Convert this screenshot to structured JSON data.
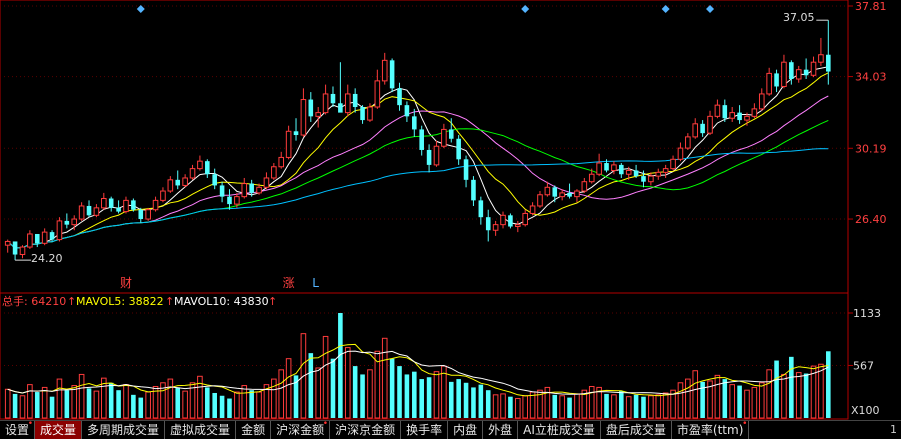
{
  "colors": {
    "up": "#ff3c3c",
    "down": "#54ffff",
    "ma5": "#ffffff",
    "ma10": "#ffff00",
    "ma20": "#ff80ff",
    "ma30": "#00ff00",
    "ma60": "#00c0ff",
    "axis": "#b40000",
    "grid": "#5a0000",
    "label": "#ff4040",
    "marker": "#54b4ff"
  },
  "price_panel": {
    "y_ticks": [
      "37.81",
      "34.03",
      "30.19",
      "26.40"
    ],
    "y_tick_values": [
      37.81,
      34.03,
      30.19,
      26.4
    ],
    "ylim": [
      22.6,
      37.81
    ],
    "high_label": "37.05",
    "low_label": "24.20",
    "event_labels": [
      {
        "text": "财",
        "index": 16
      },
      {
        "text": "涨",
        "index": 38
      },
      {
        "text": "L",
        "index": 42
      }
    ],
    "marker_indices": [
      18,
      70,
      89,
      95
    ]
  },
  "volume_panel": {
    "title": "总手",
    "total_label": "总手: 64210",
    "mavol5_label": "MAVOL5: 38822",
    "mavol10_label": "MAVOL10: 43830",
    "y_ticks": [
      "1133",
      "567"
    ],
    "y_tick_values": [
      1133,
      567
    ],
    "ylim": [
      0,
      1133
    ],
    "unit": "X100"
  },
  "tabs": [
    {
      "label": "设置",
      "dot": true
    },
    {
      "label": "成交量",
      "active": true
    },
    {
      "label": "多周期成交量"
    },
    {
      "label": "虚拟成交量"
    },
    {
      "label": "金额"
    },
    {
      "label": "沪深金额",
      "dot": true
    },
    {
      "label": "沪深京金额"
    },
    {
      "label": "换手率"
    },
    {
      "label": "内盘"
    },
    {
      "label": "外盘"
    },
    {
      "label": "AI立桩成交量"
    },
    {
      "label": "盘后成交量"
    },
    {
      "label": "市盈率(ttm)",
      "dot": true
    }
  ],
  "tab_right": "1",
  "chart_data": {
    "type": "candlestick",
    "candles": [
      [
        25.0,
        25.3,
        24.6,
        25.2
      ],
      [
        25.2,
        25.1,
        24.2,
        24.5
      ],
      [
        24.5,
        25.0,
        24.3,
        24.9
      ],
      [
        24.9,
        25.8,
        24.8,
        25.6
      ],
      [
        25.6,
        25.5,
        24.9,
        25.1
      ],
      [
        25.1,
        25.9,
        25.0,
        25.7
      ],
      [
        25.7,
        25.8,
        25.2,
        25.3
      ],
      [
        25.3,
        26.5,
        25.2,
        26.3
      ],
      [
        26.3,
        26.7,
        25.9,
        26.1
      ],
      [
        26.1,
        26.6,
        25.8,
        26.4
      ],
      [
        26.4,
        27.3,
        26.3,
        27.1
      ],
      [
        27.1,
        27.4,
        26.5,
        26.6
      ],
      [
        26.6,
        27.2,
        26.5,
        27.0
      ],
      [
        27.0,
        27.8,
        26.9,
        27.5
      ],
      [
        27.5,
        27.6,
        26.8,
        27.0
      ],
      [
        27.0,
        27.4,
        26.7,
        26.8
      ],
      [
        26.8,
        27.6,
        26.7,
        27.4
      ],
      [
        27.4,
        27.5,
        26.8,
        26.9
      ],
      [
        26.9,
        27.0,
        26.2,
        26.4
      ],
      [
        26.4,
        27.0,
        26.3,
        26.9
      ],
      [
        26.9,
        27.6,
        26.8,
        27.4
      ],
      [
        27.4,
        28.1,
        27.3,
        27.9
      ],
      [
        27.9,
        28.7,
        27.8,
        28.5
      ],
      [
        28.5,
        29.0,
        28.0,
        28.2
      ],
      [
        28.2,
        28.8,
        28.1,
        28.6
      ],
      [
        28.6,
        29.3,
        28.5,
        29.1
      ],
      [
        29.1,
        29.8,
        29.0,
        29.5
      ],
      [
        29.5,
        29.6,
        28.6,
        28.8
      ],
      [
        28.8,
        29.1,
        28.0,
        28.2
      ],
      [
        28.2,
        28.4,
        27.3,
        27.6
      ],
      [
        27.6,
        28.0,
        26.9,
        27.2
      ],
      [
        27.2,
        27.8,
        27.0,
        27.6
      ],
      [
        27.6,
        28.6,
        27.5,
        28.3
      ],
      [
        28.3,
        28.5,
        27.6,
        27.8
      ],
      [
        27.8,
        28.3,
        27.7,
        28.1
      ],
      [
        28.1,
        28.9,
        28.0,
        28.6
      ],
      [
        28.6,
        29.4,
        28.5,
        29.2
      ],
      [
        29.2,
        30.0,
        29.1,
        29.7
      ],
      [
        29.7,
        31.4,
        29.6,
        31.1
      ],
      [
        31.1,
        31.8,
        30.6,
        30.9
      ],
      [
        30.9,
        33.4,
        30.8,
        32.8
      ],
      [
        32.8,
        33.2,
        31.6,
        31.9
      ],
      [
        31.9,
        32.4,
        31.3,
        32.1
      ],
      [
        32.1,
        33.6,
        32.0,
        33.1
      ],
      [
        33.1,
        33.5,
        32.4,
        32.6
      ],
      [
        32.6,
        34.8,
        32.5,
        32.1
      ],
      [
        32.1,
        33.6,
        31.9,
        33.1
      ],
      [
        33.1,
        33.4,
        32.1,
        32.4
      ],
      [
        32.4,
        32.5,
        31.5,
        31.7
      ],
      [
        31.7,
        32.6,
        31.6,
        32.4
      ],
      [
        32.4,
        34.4,
        32.3,
        33.8
      ],
      [
        33.8,
        35.3,
        33.6,
        34.9
      ],
      [
        34.9,
        35.0,
        33.2,
        33.4
      ],
      [
        33.4,
        33.7,
        32.2,
        32.5
      ],
      [
        32.5,
        32.7,
        31.6,
        31.9
      ],
      [
        31.9,
        32.3,
        30.8,
        31.2
      ],
      [
        31.2,
        31.4,
        29.8,
        30.1
      ],
      [
        30.1,
        30.4,
        28.9,
        29.3
      ],
      [
        29.3,
        30.6,
        29.2,
        30.3
      ],
      [
        30.3,
        31.5,
        30.2,
        31.2
      ],
      [
        31.2,
        31.8,
        30.5,
        30.7
      ],
      [
        30.7,
        30.9,
        29.3,
        29.6
      ],
      [
        29.6,
        29.8,
        28.1,
        28.5
      ],
      [
        28.5,
        28.7,
        27.1,
        27.4
      ],
      [
        27.4,
        27.6,
        26.1,
        26.5
      ],
      [
        26.5,
        26.9,
        25.2,
        25.8
      ],
      [
        25.8,
        26.3,
        25.5,
        26.1
      ],
      [
        26.1,
        26.8,
        25.9,
        26.6
      ],
      [
        26.6,
        26.7,
        25.9,
        26.0
      ],
      [
        26.0,
        26.3,
        25.7,
        26.1
      ],
      [
        26.1,
        26.9,
        26.0,
        26.7
      ],
      [
        26.7,
        27.3,
        26.6,
        27.1
      ],
      [
        27.1,
        27.9,
        27.0,
        27.7
      ],
      [
        27.7,
        28.4,
        27.6,
        28.1
      ],
      [
        28.1,
        28.2,
        27.3,
        27.6
      ],
      [
        27.6,
        28.0,
        27.4,
        27.8
      ],
      [
        27.8,
        28.3,
        27.5,
        27.6
      ],
      [
        27.6,
        28.0,
        27.3,
        27.9
      ],
      [
        27.9,
        28.6,
        27.8,
        28.4
      ],
      [
        28.4,
        29.1,
        28.3,
        28.8
      ],
      [
        28.8,
        29.9,
        28.7,
        29.4
      ],
      [
        29.4,
        29.6,
        28.9,
        29.0
      ],
      [
        29.0,
        29.5,
        28.8,
        29.3
      ],
      [
        29.3,
        29.4,
        28.6,
        28.8
      ],
      [
        28.8,
        29.2,
        28.5,
        29.0
      ],
      [
        29.0,
        29.3,
        28.6,
        28.7
      ],
      [
        28.7,
        29.0,
        28.1,
        28.4
      ],
      [
        28.4,
        28.9,
        28.2,
        28.7
      ],
      [
        28.7,
        29.1,
        28.5,
        28.9
      ],
      [
        28.9,
        29.3,
        28.6,
        29.1
      ],
      [
        29.1,
        29.8,
        29.0,
        29.6
      ],
      [
        29.6,
        30.5,
        29.5,
        30.2
      ],
      [
        30.2,
        31.0,
        30.1,
        30.8
      ],
      [
        30.8,
        31.8,
        30.7,
        31.5
      ],
      [
        31.5,
        31.7,
        30.8,
        31.0
      ],
      [
        31.0,
        32.2,
        30.9,
        31.9
      ],
      [
        31.9,
        32.8,
        31.8,
        32.5
      ],
      [
        32.5,
        32.8,
        31.6,
        31.8
      ],
      [
        31.8,
        32.4,
        31.6,
        32.1
      ],
      [
        32.1,
        32.5,
        31.5,
        31.7
      ],
      [
        31.7,
        32.1,
        31.4,
        31.9
      ],
      [
        31.9,
        32.6,
        31.8,
        32.3
      ],
      [
        32.3,
        33.4,
        32.2,
        33.1
      ],
      [
        33.1,
        34.5,
        33.0,
        34.2
      ],
      [
        34.2,
        34.4,
        33.2,
        33.5
      ],
      [
        33.5,
        35.2,
        33.4,
        34.8
      ],
      [
        34.8,
        34.9,
        33.6,
        33.9
      ],
      [
        33.9,
        34.6,
        33.7,
        34.4
      ],
      [
        34.4,
        35.0,
        33.9,
        34.1
      ],
      [
        34.1,
        35.1,
        34.0,
        34.8
      ],
      [
        34.8,
        36.1,
        34.6,
        35.2
      ],
      [
        35.2,
        37.05,
        33.6,
        34.3
      ]
    ],
    "volume": [
      310,
      260,
      240,
      360,
      280,
      330,
      230,
      420,
      300,
      350,
      470,
      320,
      290,
      430,
      380,
      300,
      360,
      250,
      220,
      280,
      340,
      380,
      420,
      330,
      290,
      380,
      450,
      330,
      270,
      240,
      210,
      280,
      350,
      300,
      280,
      360,
      420,
      520,
      640,
      460,
      910,
      700,
      540,
      880,
      640,
      1133,
      760,
      560,
      470,
      520,
      720,
      860,
      640,
      560,
      470,
      500,
      420,
      440,
      500,
      560,
      390,
      420,
      380,
      330,
      360,
      300,
      250,
      260,
      230,
      210,
      240,
      280,
      300,
      330,
      250,
      240,
      220,
      260,
      300,
      340,
      330,
      260,
      250,
      290,
      230,
      250,
      230,
      240,
      250,
      270,
      300,
      380,
      420,
      510,
      390,
      400,
      460,
      420,
      360,
      350,
      300,
      330,
      380,
      520,
      620,
      470,
      660,
      490,
      480,
      560,
      580,
      720
    ],
    "ma_series": [
      "MA5",
      "MA10",
      "MA20",
      "MA30",
      "MA60"
    ]
  }
}
